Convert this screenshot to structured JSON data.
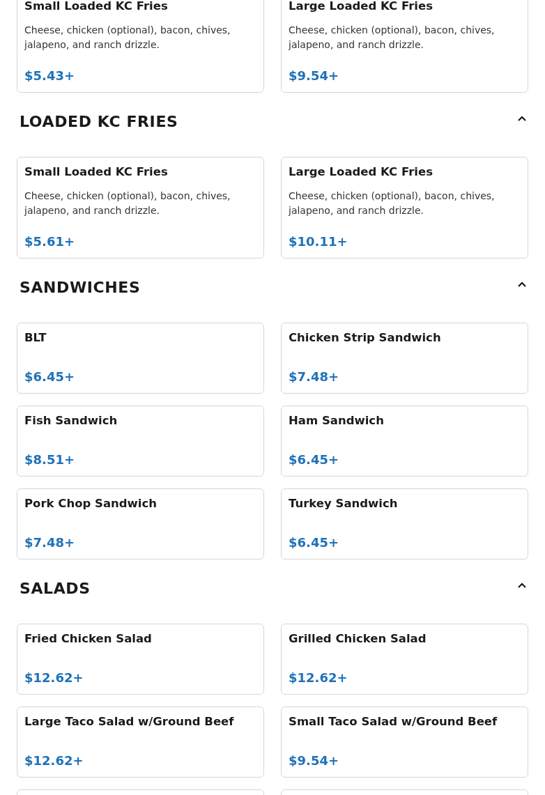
{
  "sections": [
    {
      "items": [
        {
          "name": "Small Loaded KC Fries",
          "description": "Cheese, chicken (optional), bacon, chives, jalapeno, and ranch drizzle.",
          "price": "$5.43+"
        },
        {
          "name": "Large Loaded KC Fries",
          "description": "Cheese, chicken (optional), bacon, chives, jalapeno, and ranch drizzle.",
          "price": "$9.54+"
        }
      ]
    },
    {
      "title": "LOADED KC FRIES",
      "expanded": true,
      "items": [
        {
          "name": "Small Loaded KC Fries",
          "description": "Cheese, chicken (optional), bacon, chives, jalapeno, and ranch drizzle.",
          "price": "$5.61+"
        },
        {
          "name": "Large Loaded KC Fries",
          "description": "Cheese, chicken (optional), bacon, chives, jalapeno, and ranch drizzle.",
          "price": "$10.11+"
        }
      ]
    },
    {
      "title": "SANDWICHES",
      "expanded": true,
      "items": [
        {
          "name": "BLT",
          "price": "$6.45+"
        },
        {
          "name": "Chicken Strip Sandwich",
          "price": "$7.48+"
        },
        {
          "name": "Fish Sandwich",
          "price": "$8.51+"
        },
        {
          "name": "Ham Sandwich",
          "price": "$6.45+"
        },
        {
          "name": "Pork Chop Sandwich",
          "price": "$7.48+"
        },
        {
          "name": "Turkey Sandwich",
          "price": "$6.45+"
        }
      ]
    },
    {
      "title": "SALADS",
      "expanded": true,
      "items": [
        {
          "kind": "item",
          "name": "Fried Chicken Salad",
          "price": "$12.62+"
        },
        {
          "kind": "item",
          "name": "Grilled Chicken Salad",
          "price": "$12.62+"
        },
        {
          "kind": "item",
          "name": "Large Taco Salad w/Ground Beef",
          "price": "$12.62+"
        },
        {
          "kind": "item",
          "name": "Small Taco Salad w/Ground Beef",
          "price": "$9.54+"
        },
        {
          "kind": "cut_off"
        },
        {
          "kind": "cut_off"
        }
      ]
    }
  ]
}
